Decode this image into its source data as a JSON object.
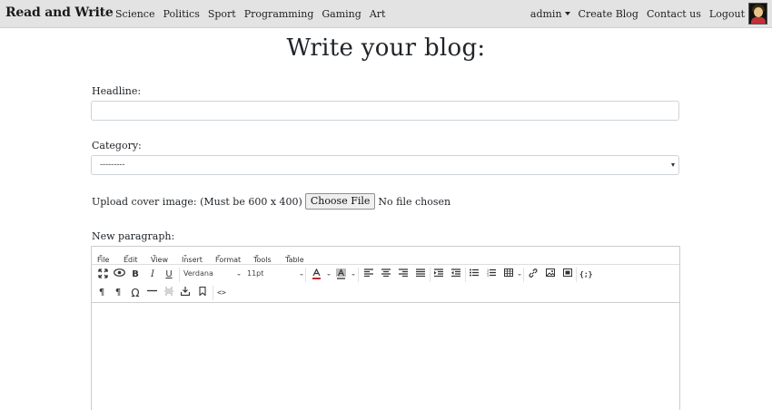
{
  "navbar": {
    "brand": "Read and Write",
    "links": [
      "Science",
      "Politics",
      "Sport",
      "Programming",
      "Gaming",
      "Art"
    ],
    "user_menu": "admin",
    "create_blog": "Create Blog",
    "contact_us": "Contact us",
    "logout": "Logout"
  },
  "page": {
    "title": "Write your blog:"
  },
  "form": {
    "headline_label": "Headline:",
    "headline_value": "",
    "category_label": "Category:",
    "category_selected": "---------",
    "upload_label": "Upload cover image: (Must be 600 x 400)",
    "choose_file_label": "Choose File",
    "file_status": "No file chosen",
    "paragraph_label": "New paragraph:"
  },
  "editor": {
    "menus": [
      "File",
      "Edit",
      "View",
      "Insert",
      "Format",
      "Tools",
      "Table"
    ],
    "font_family": "Verdana",
    "font_size": "11pt",
    "toolbar_icons": [
      "fullscreen-icon",
      "preview-icon",
      "bold-icon",
      "italic-icon",
      "underline-icon",
      "font-family-select",
      "font-size-select",
      "text-color-icon",
      "background-color-icon",
      "align-left-icon",
      "align-center-icon",
      "align-right-icon",
      "align-justify-icon",
      "indent-icon",
      "outdent-icon",
      "bullet-list-icon",
      "numbered-list-icon",
      "table-icon",
      "link-icon",
      "image-icon",
      "media-icon",
      "code-sample-icon",
      "ltr-icon",
      "rtl-icon",
      "special-char-icon",
      "horizontal-rule-icon",
      "page-break-icon",
      "template-icon",
      "anchor-icon",
      "source-code-icon"
    ]
  }
}
